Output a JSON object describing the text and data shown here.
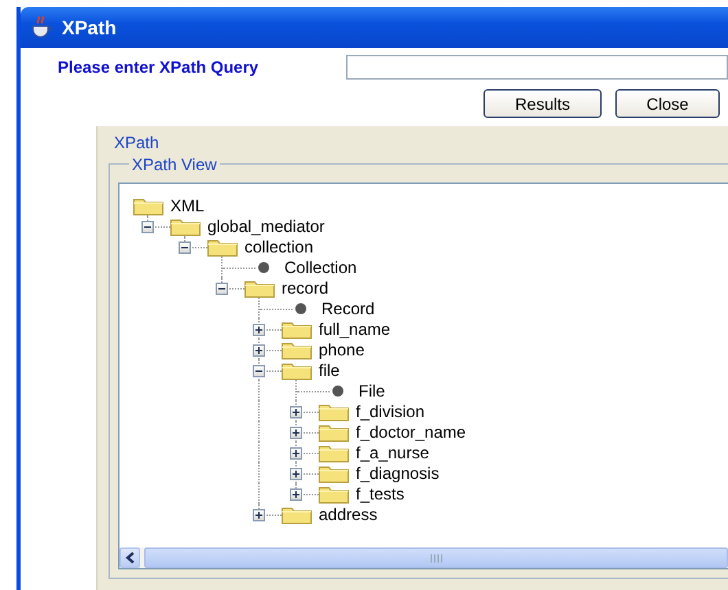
{
  "window": {
    "title": "XPath"
  },
  "query": {
    "label": "Please enter XPath Query"
  },
  "buttons": [
    "Results",
    "Close"
  ],
  "group": {
    "title": "XPath"
  },
  "view": {
    "title": "XPath View"
  },
  "tree": [
    {
      "label": "XML",
      "kind": "root",
      "children": [
        {
          "label": "global_mediator",
          "kind": "folder",
          "expanded": true,
          "children": [
            {
              "label": "collection",
              "kind": "folder",
              "expanded": true,
              "children": [
                {
                  "label": "Collection",
                  "kind": "leaf"
                },
                {
                  "label": "record",
                  "kind": "folder",
                  "expanded": true,
                  "children": [
                    {
                      "label": "Record",
                      "kind": "leaf"
                    },
                    {
                      "label": "full_name",
                      "kind": "folder",
                      "expanded": false
                    },
                    {
                      "label": "phone",
                      "kind": "folder",
                      "expanded": false
                    },
                    {
                      "label": "file",
                      "kind": "folder",
                      "expanded": true,
                      "children": [
                        {
                          "label": "File",
                          "kind": "leaf"
                        },
                        {
                          "label": "f_division",
                          "kind": "folder",
                          "expanded": false
                        },
                        {
                          "label": "f_doctor_name",
                          "kind": "folder",
                          "expanded": false
                        },
                        {
                          "label": "f_a_nurse",
                          "kind": "folder",
                          "expanded": false
                        },
                        {
                          "label": "f_diagnosis",
                          "kind": "folder",
                          "expanded": false
                        },
                        {
                          "label": "f_tests",
                          "kind": "folder",
                          "expanded": false
                        }
                      ]
                    },
                    {
                      "label": "address",
                      "kind": "folder",
                      "expanded": false
                    }
                  ]
                }
              ]
            }
          ]
        }
      ]
    }
  ]
}
